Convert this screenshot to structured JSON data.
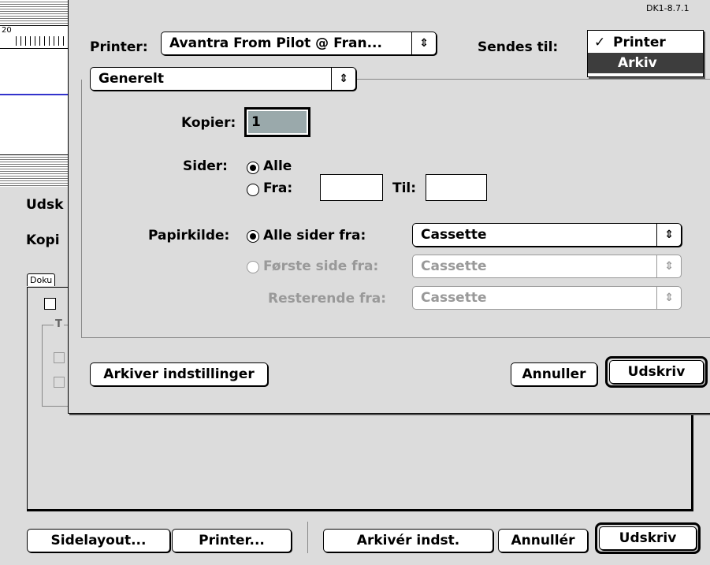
{
  "version_label": "DK1-8.7.1",
  "background_dialog": {
    "ruler_number": "20",
    "title_fragment_1": "Udsk",
    "title_fragment_2": "Kopi",
    "tab_fragment": "Doku",
    "group_fragment": "T",
    "buttons": {
      "page_layout": "Sidelayout...",
      "printer": "Printer...",
      "save_settings": "Arkivér indst.",
      "cancel": "Annullér",
      "print": "Udskriv"
    }
  },
  "print_dialog": {
    "printer_label": "Printer:",
    "printer_value": "Avantra From Pilot @ Fran...",
    "send_to_label": "Sendes til:",
    "send_to_menu": {
      "items": [
        {
          "label": "Printer",
          "checked": true,
          "check_mark": "✓"
        },
        {
          "label": "Arkiv",
          "highlighted": true
        }
      ]
    },
    "section_popup": "Generelt",
    "copies_label": "Kopier:",
    "copies_value": "1",
    "pages_label": "Sider:",
    "pages_all": "Alle",
    "pages_from": "Fra:",
    "pages_to": "Til:",
    "pages_from_value": "",
    "pages_to_value": "",
    "paper_source_label": "Papirkilde:",
    "paper_all_pages": "Alle sider fra:",
    "paper_all_pages_value": "Cassette",
    "paper_first_page": "Første side fra:",
    "paper_first_page_value": "Cassette",
    "paper_remaining": "Resterende fra:",
    "paper_remaining_value": "Cassette",
    "buttons": {
      "save_settings": "Arkiver indstillinger",
      "cancel": "Annuller",
      "print": "Udskriv"
    },
    "arrows": "⇕"
  }
}
